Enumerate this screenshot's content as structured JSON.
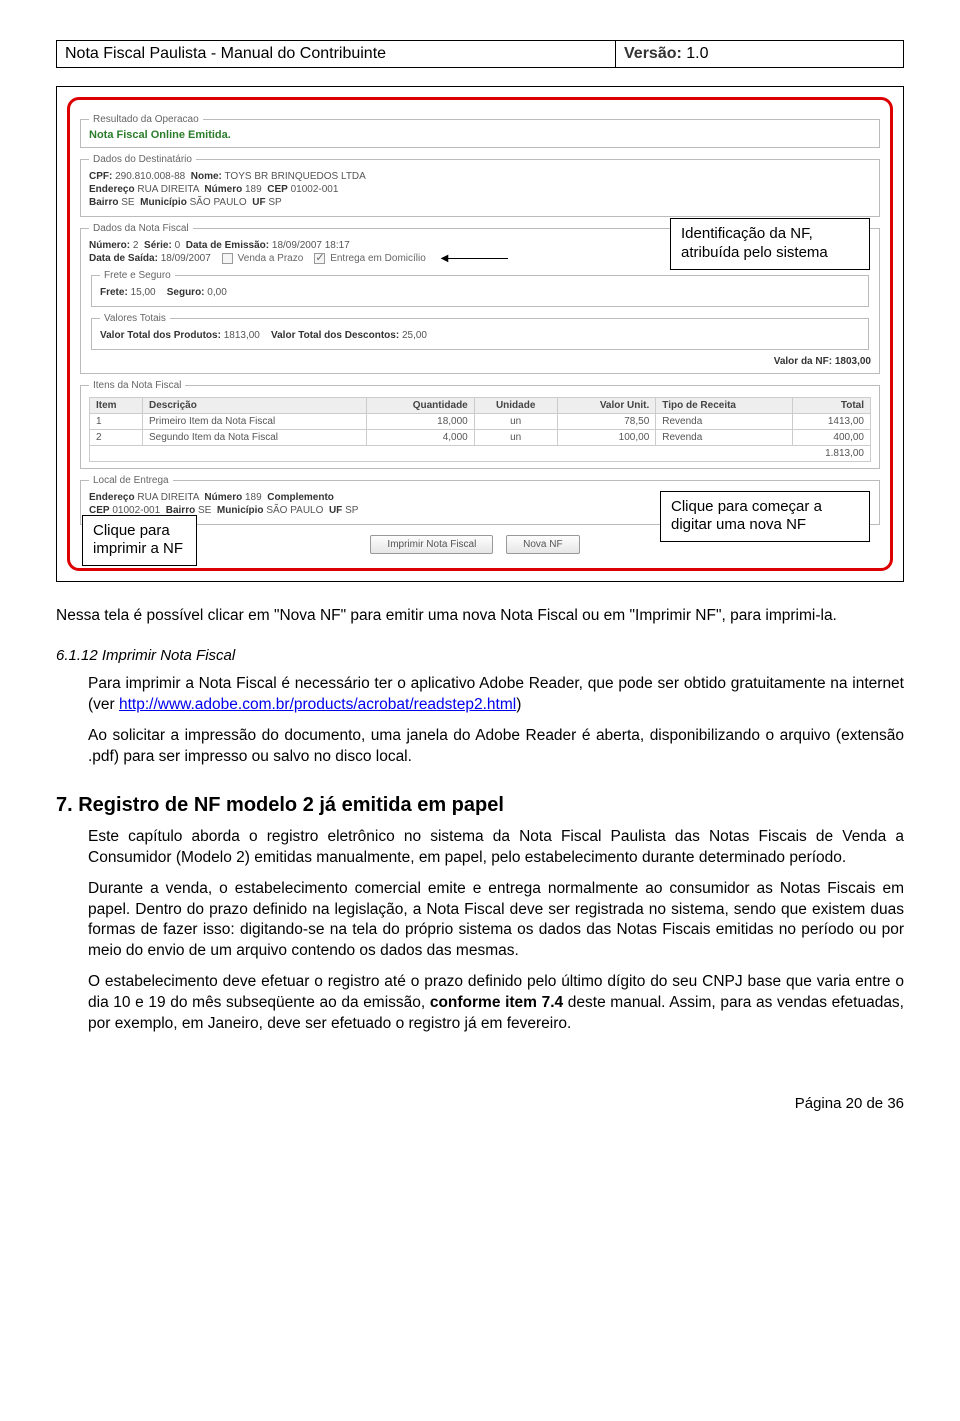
{
  "header": {
    "title": "Nota Fiscal Paulista - Manual do Contribuinte",
    "version_label": "Versão:",
    "version_value": "1.0"
  },
  "figure": {
    "resultado_legend": "Resultado da Operacao",
    "resultado_text": "Nota Fiscal Online Emitida.",
    "dest_legend": "Dados do Destinatário",
    "dest_cpf_lbl": "CPF:",
    "dest_cpf": "290.810.008-88",
    "dest_nome_lbl": "Nome:",
    "dest_nome": "TOYS BR BRINQUEDOS LTDA",
    "dest_end_lbl": "Endereço",
    "dest_end": "RUA DIREITA",
    "dest_num_lbl": "Número",
    "dest_num": "189",
    "dest_cep_lbl": "CEP",
    "dest_cep": "01002-001",
    "dest_bairro_lbl": "Bairro",
    "dest_bairro": "SE",
    "dest_mun_lbl": "Município",
    "dest_mun": "SÃO PAULO",
    "dest_uf_lbl": "UF",
    "dest_uf": "SP",
    "nf_legend": "Dados da Nota Fiscal",
    "nf_numero_lbl": "Número:",
    "nf_numero": "2",
    "nf_serie_lbl": "Série:",
    "nf_serie": "0",
    "nf_emissao_lbl": "Data de Emissão:",
    "nf_emissao": "18/09/2007 18:17",
    "nf_saida_lbl": "Data de Saída:",
    "nf_saida": "18/09/2007",
    "nf_venda_prazo": "Venda a Prazo",
    "nf_entrega_dom": "Entrega em Domicílio",
    "frete_legend": "Frete e Seguro",
    "frete_lbl": "Frete:",
    "frete": "15,00",
    "seguro_lbl": "Seguro:",
    "seguro": "0,00",
    "valores_legend": "Valores Totais",
    "valor_prod_lbl": "Valor Total dos Produtos:",
    "valor_prod": "1813,00",
    "valor_desc_lbl": "Valor Total dos Descontos:",
    "valor_desc": "25,00",
    "valor_nf_lbl": "Valor da NF:",
    "valor_nf": "1803,00",
    "itens_legend": "Itens da Nota Fiscal",
    "cols": {
      "item": "Item",
      "desc": "Descrição",
      "qtd": "Quantidade",
      "unid": "Unidade",
      "vunit": "Valor Unit.",
      "tipo": "Tipo de Receita",
      "total": "Total"
    },
    "items": [
      {
        "n": "1",
        "desc": "Primeiro Item da Nota Fiscal",
        "qtd": "18,000",
        "un": "un",
        "vu": "78,50",
        "tipo": "Revenda",
        "tot": "1413,00"
      },
      {
        "n": "2",
        "desc": "Segundo Item da Nota Fiscal",
        "qtd": "4,000",
        "un": "un",
        "vu": "100,00",
        "tipo": "Revenda",
        "tot": "400,00"
      }
    ],
    "items_total": "1.813,00",
    "local_legend": "Local de Entrega",
    "local_end_lbl": "Endereço",
    "local_end": "RUA DIREITA",
    "local_num_lbl": "Número",
    "local_num": "189",
    "local_comp_lbl": "Complemento",
    "local_cep_lbl": "CEP",
    "local_cep": "01002-001",
    "local_bairro_lbl": "Bairro",
    "local_bairro": "SE",
    "local_mun_lbl": "Município",
    "local_mun": "SÃO PAULO",
    "local_uf_lbl": "UF",
    "local_uf": "SP",
    "btn_imprimir": "Imprimir Nota Fiscal",
    "btn_nova": "Nova NF",
    "callout_id": "Identificação da NF, atribuída pelo sistema",
    "callout_print": "Clique para imprimir a NF",
    "callout_new": "Clique para começar a digitar uma nova NF"
  },
  "text": {
    "p1": "Nessa tela é possível clicar em \"Nova NF\" para emitir uma nova Nota Fiscal ou em \"Imprimir NF\", para imprimi-la.",
    "sec_num": "6.1.12    Imprimir Nota Fiscal",
    "p2a": "Para imprimir a Nota Fiscal é necessário ter o aplicativo Adobe Reader, que pode ser obtido gratuitamente na internet (ver ",
    "p2_link": "http://www.adobe.com.br/products/acrobat/readstep2.html",
    "p2b": ")",
    "p3": "Ao solicitar a impressão do documento, uma janela do Adobe Reader é aberta, disponibilizando o arquivo (extensão .pdf) para ser impresso ou salvo no disco local.",
    "h7": "7.  Registro de NF modelo 2 já emitida em papel",
    "p4": "Este capítulo aborda o registro eletrônico no sistema da Nota Fiscal Paulista das Notas Fiscais de Venda a Consumidor (Modelo 2) emitidas manualmente, em papel, pelo estabelecimento durante determinado período.",
    "p5": "Durante a venda, o estabelecimento comercial emite e entrega normalmente ao consumidor as Notas Fiscais em papel. Dentro do prazo definido na legislação, a Nota Fiscal deve ser registrada no sistema, sendo que existem duas formas de fazer isso: digitando-se na tela do próprio sistema os dados das Notas Fiscais emitidas no período ou por meio do envio de um arquivo contendo os dados das mesmas.",
    "p6a": "O estabelecimento deve efetuar o registro até o prazo definido pelo último dígito do seu CNPJ base que varia entre o dia 10 e 19 do mês subseqüente ao da emissão, ",
    "p6b_bold": "conforme item 7.4",
    "p6c": " deste manual. Assim, para as vendas efetuadas, por exemplo, em Janeiro, deve ser efetuado o registro já em fevereiro."
  },
  "footer": {
    "text": "Página 20 de 36"
  }
}
